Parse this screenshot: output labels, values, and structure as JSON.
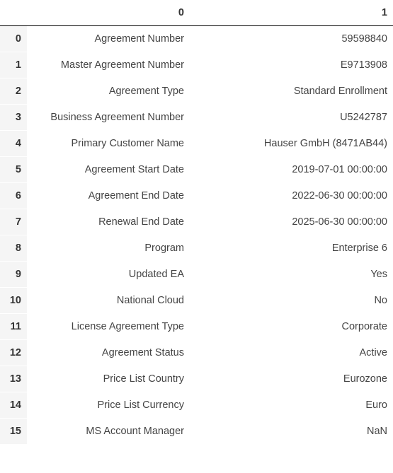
{
  "table": {
    "headers": [
      "0",
      "1"
    ],
    "rows": [
      {
        "idx": "0",
        "label": "Agreement Number",
        "value": "59598840"
      },
      {
        "idx": "1",
        "label": "Master Agreement Number",
        "value": "E9713908"
      },
      {
        "idx": "2",
        "label": "Agreement Type",
        "value": "Standard Enrollment"
      },
      {
        "idx": "3",
        "label": "Business Agreement Number",
        "value": "U5242787"
      },
      {
        "idx": "4",
        "label": "Primary Customer Name",
        "value": "Hauser GmbH (8471AB44)"
      },
      {
        "idx": "5",
        "label": "Agreement Start Date",
        "value": "2019-07-01 00:00:00"
      },
      {
        "idx": "6",
        "label": "Agreement End Date",
        "value": "2022-06-30 00:00:00"
      },
      {
        "idx": "7",
        "label": "Renewal End Date",
        "value": "2025-06-30 00:00:00"
      },
      {
        "idx": "8",
        "label": "Program",
        "value": "Enterprise 6"
      },
      {
        "idx": "9",
        "label": "Updated EA",
        "value": "Yes"
      },
      {
        "idx": "10",
        "label": "National Cloud",
        "value": "No"
      },
      {
        "idx": "11",
        "label": "License Agreement Type",
        "value": "Corporate"
      },
      {
        "idx": "12",
        "label": "Agreement Status",
        "value": "Active"
      },
      {
        "idx": "13",
        "label": "Price List Country",
        "value": "Eurozone"
      },
      {
        "idx": "14",
        "label": "Price List Currency",
        "value": "Euro"
      },
      {
        "idx": "15",
        "label": "MS Account Manager",
        "value": "NaN"
      }
    ]
  }
}
